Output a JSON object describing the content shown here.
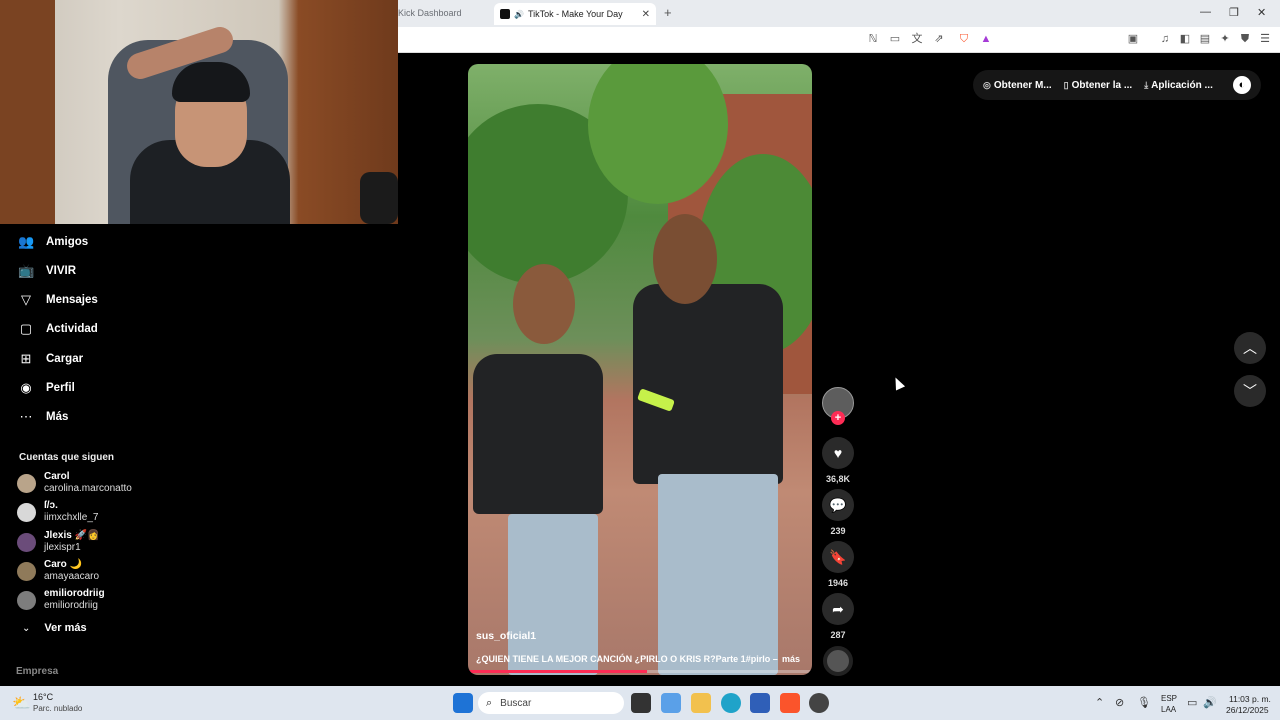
{
  "browser": {
    "tabs": [
      {
        "label": "Kick Dashboard"
      },
      {
        "label": "TikTok - Make Your Day",
        "active": true
      }
    ],
    "new_tab_icon": "plus-icon"
  },
  "sidebar": {
    "items": [
      {
        "label": "Amigos",
        "icon": "friends-icon"
      },
      {
        "label": "VIVIR",
        "icon": "live-icon"
      },
      {
        "label": "Mensajes",
        "icon": "messages-icon"
      },
      {
        "label": "Actividad",
        "icon": "activity-icon"
      },
      {
        "label": "Cargar",
        "icon": "upload-icon"
      },
      {
        "label": "Perfil",
        "icon": "profile-icon"
      },
      {
        "label": "Más",
        "icon": "more-icon"
      }
    ],
    "following_title": "Cuentas que siguen",
    "accounts": [
      {
        "name": "Carol",
        "handle": "carolina.marconatto"
      },
      {
        "name": "ſ/ↄ.",
        "handle": "iimxchxlle_7"
      },
      {
        "name": "Jlexis 🚀👩",
        "handle": "jlexispr1"
      },
      {
        "name": "Caro 🌙",
        "handle": "amayaacaro"
      },
      {
        "name": "emiliorodriig",
        "handle": "emiliorodriig"
      }
    ],
    "see_more": "Ver más",
    "company": "Empresa"
  },
  "video": {
    "username": "sus_oficial1",
    "caption": "¿QUIEN TIENE LA MEJOR CANCIÓN ¿PIRLO O KRIS R?Parte 1#pirlo –",
    "more": "más",
    "progress": 0.52
  },
  "actions": {
    "likes": "36,8K",
    "comments": "239",
    "saves": "1946",
    "shares": "287"
  },
  "top_pill": {
    "items": [
      {
        "label": "Obtener M...",
        "icon": "coin-icon"
      },
      {
        "label": "Obtener la ...",
        "icon": "phone-icon"
      },
      {
        "label": "Aplicación ...",
        "icon": "download-icon"
      }
    ]
  },
  "taskbar": {
    "temp": "16°C",
    "weather": "Parc. nublado",
    "search_placeholder": "Buscar",
    "lang_top": "ESP",
    "lang_bottom": "LAA",
    "time": "11:03 p. m.",
    "date": "26/12/2025"
  }
}
